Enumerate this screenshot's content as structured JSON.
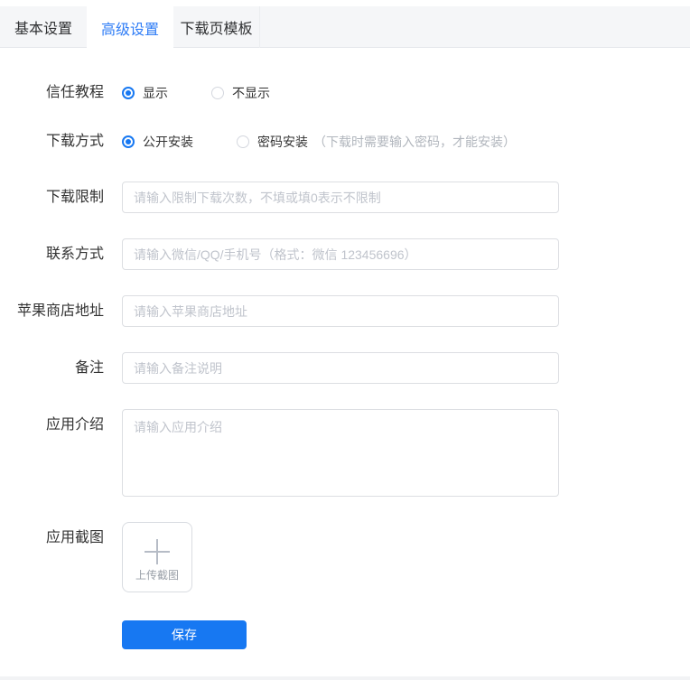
{
  "tabs": [
    {
      "label": "基本设置",
      "active": false
    },
    {
      "label": "高级设置",
      "active": true
    },
    {
      "label": "下载页模板",
      "active": false
    }
  ],
  "form": {
    "trust_tutorial": {
      "label": "信任教程",
      "options": [
        {
          "label": "显示",
          "selected": true
        },
        {
          "label": "不显示",
          "selected": false
        }
      ]
    },
    "download_method": {
      "label": "下载方式",
      "options": [
        {
          "label": "公开安装",
          "selected": true
        },
        {
          "label": "密码安装",
          "selected": false
        }
      ],
      "note": "（下载时需要输入密码，才能安装）"
    },
    "download_limit": {
      "label": "下载限制",
      "value": "",
      "placeholder": "请输入限制下载次数，不填或填0表示不限制"
    },
    "contact": {
      "label": "联系方式",
      "value": "",
      "placeholder": "请输入微信/QQ/手机号（格式：微信 123456696）"
    },
    "apple_store": {
      "label": "苹果商店地址",
      "value": "",
      "placeholder": "请输入苹果商店地址"
    },
    "remark": {
      "label": "备注",
      "value": "",
      "placeholder": "请输入备注说明"
    },
    "app_intro": {
      "label": "应用介绍",
      "value": "",
      "placeholder": "请输入应用介绍"
    },
    "screenshots": {
      "label": "应用截图",
      "upload_label": "上传截图"
    },
    "save_label": "保存"
  },
  "colors": {
    "accent": "#1778f2",
    "tabbar_bg": "#f5f6f8",
    "placeholder": "#c0c4cc",
    "note_gray": "#b1b6bd"
  }
}
